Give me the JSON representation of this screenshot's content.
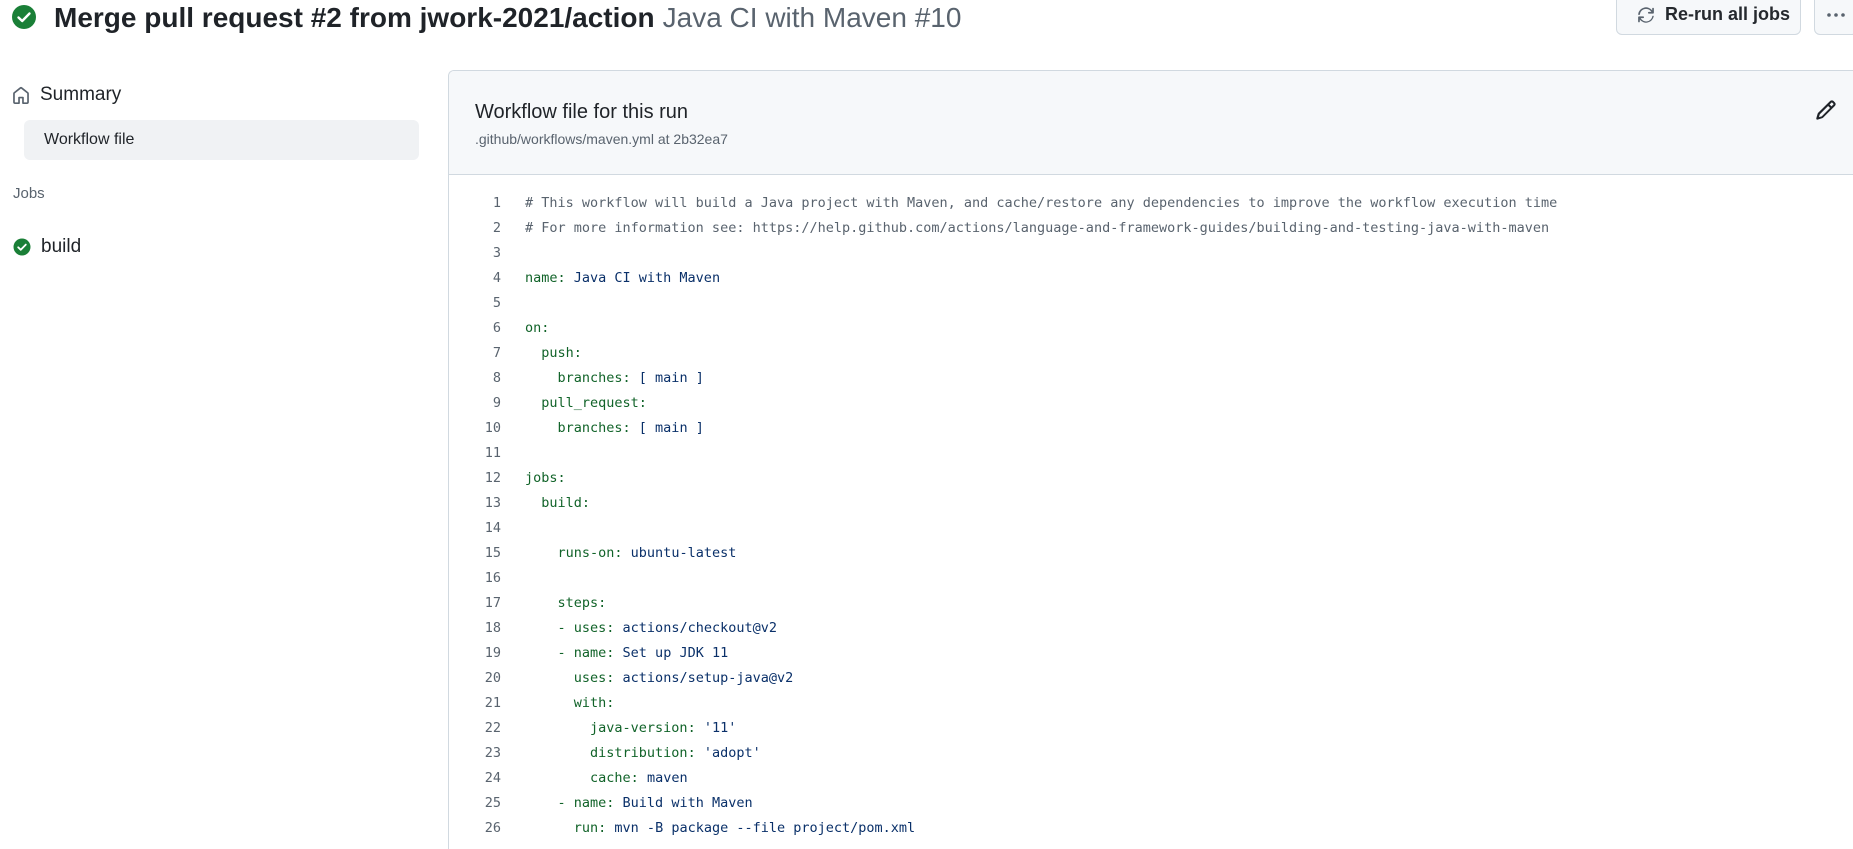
{
  "header": {
    "title_main": "Merge pull request #2 from jwork-2021/action",
    "title_sub": "Java CI with Maven #10",
    "rerun_label": "Re-run all jobs",
    "status_color": "#1a7f37"
  },
  "sidebar": {
    "summary_label": "Summary",
    "workflow_file_label": "Workflow file",
    "jobs_heading": "Jobs",
    "jobs": [
      {
        "label": "build",
        "status": "success"
      }
    ]
  },
  "panel": {
    "title": "Workflow file for this run",
    "subtitle": ".github/workflows/maven.yml at 2b32ea7"
  },
  "code": {
    "lines": [
      {
        "n": "1",
        "indent": "",
        "comment": "# This workflow will build a Java project with Maven, and cache/restore any dependencies to improve the workflow execution time"
      },
      {
        "n": "2",
        "indent": "",
        "comment": "# For more information see: https://help.github.com/actions/language-and-framework-guides/building-and-testing-java-with-maven"
      },
      {
        "n": "3",
        "indent": ""
      },
      {
        "n": "4",
        "indent": "",
        "key": "name:",
        "val": " Java CI with Maven"
      },
      {
        "n": "5",
        "indent": ""
      },
      {
        "n": "6",
        "indent": "",
        "key": "on:"
      },
      {
        "n": "7",
        "indent": "  ",
        "key": "push:"
      },
      {
        "n": "8",
        "indent": "    ",
        "key": "branches:",
        "val": " [ main ]"
      },
      {
        "n": "9",
        "indent": "  ",
        "key": "pull_request:"
      },
      {
        "n": "10",
        "indent": "    ",
        "key": "branches:",
        "val": " [ main ]"
      },
      {
        "n": "11",
        "indent": ""
      },
      {
        "n": "12",
        "indent": "",
        "key": "jobs:"
      },
      {
        "n": "13",
        "indent": "  ",
        "key": "build:"
      },
      {
        "n": "14",
        "indent": ""
      },
      {
        "n": "15",
        "indent": "    ",
        "key": "runs-on:",
        "val": " ubuntu-latest"
      },
      {
        "n": "16",
        "indent": ""
      },
      {
        "n": "17",
        "indent": "    ",
        "key": "steps:"
      },
      {
        "n": "18",
        "indent": "    ",
        "dash": "- ",
        "key": "uses:",
        "val": " actions/checkout@v2"
      },
      {
        "n": "19",
        "indent": "    ",
        "dash": "- ",
        "key": "name:",
        "val": " Set up JDK 11"
      },
      {
        "n": "20",
        "indent": "      ",
        "key": "uses:",
        "val": " actions/setup-java@v2"
      },
      {
        "n": "21",
        "indent": "      ",
        "key": "with:"
      },
      {
        "n": "22",
        "indent": "        ",
        "key": "java-version:",
        "val": " '11'"
      },
      {
        "n": "23",
        "indent": "        ",
        "key": "distribution:",
        "val": " 'adopt'"
      },
      {
        "n": "24",
        "indent": "        ",
        "key": "cache:",
        "val": " maven"
      },
      {
        "n": "25",
        "indent": "    ",
        "dash": "- ",
        "key": "name:",
        "val": " Build with Maven"
      },
      {
        "n": "26",
        "indent": "      ",
        "key": "run:",
        "val": " mvn -B package --file project/pom.xml"
      }
    ]
  }
}
